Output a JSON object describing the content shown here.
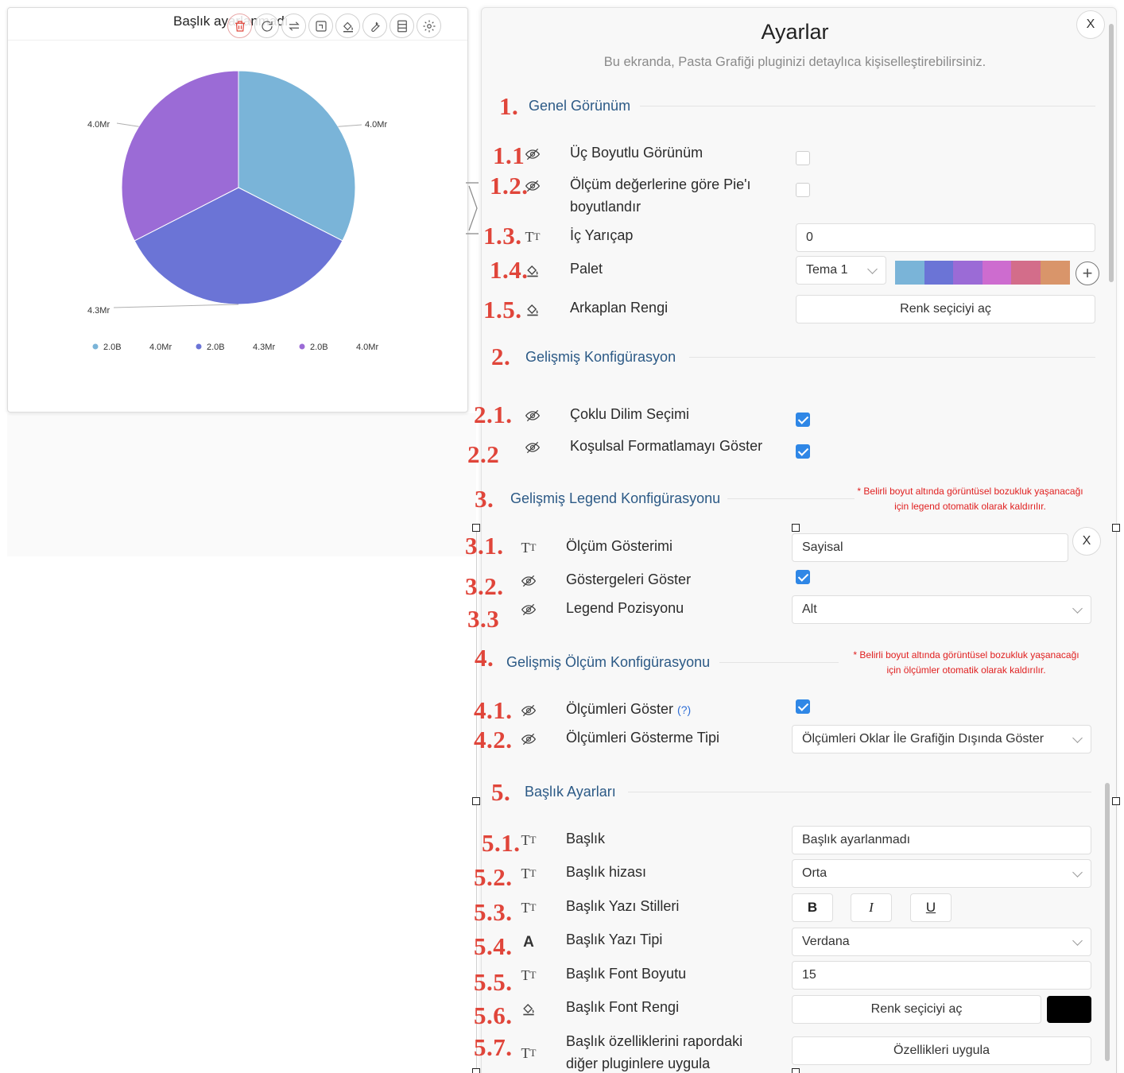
{
  "chart_card": {
    "title": "Başlık ayarlanmadı",
    "toolbar": [
      {
        "icon": "trash-icon"
      },
      {
        "icon": "refresh-icon"
      },
      {
        "icon": "swap-icon"
      },
      {
        "icon": "frame-icon"
      },
      {
        "icon": "paint-bucket-icon"
      },
      {
        "icon": "wrench-icon"
      },
      {
        "icon": "list-icon"
      },
      {
        "icon": "gear-icon"
      }
    ]
  },
  "chart_data": {
    "type": "pie",
    "title": "Başlık ayarlanmadı",
    "slices": [
      {
        "label": "4.0Mr",
        "legend_value": "2.0B",
        "legend_label": "4.0Mr",
        "value": 4.0,
        "color": "#7ab4d8"
      },
      {
        "label": "4.3Mr",
        "legend_value": "2.0B",
        "legend_label": "4.3Mr",
        "value": 4.3,
        "color": "#6b74d6"
      },
      {
        "label": "4.0Mr",
        "legend_value": "2.0B",
        "legend_label": "4.0Mr",
        "value": 4.0,
        "color": "#9b6bd6"
      }
    ],
    "legend_position": "bottom"
  },
  "panel": {
    "title": "Ayarlar",
    "subtitle": "Bu ekranda, Pasta Grafiği pluginizi detaylıca kişiselleştirebilirsiniz.",
    "close_label": "X",
    "sections": {
      "s1": {
        "num": "1.",
        "title": "Genel Görünüm"
      },
      "s2": {
        "num": "2.",
        "title": "Gelişmiş Konfigürasyon"
      },
      "s3": {
        "num": "3.",
        "title": "Gelişmiş Legend Konfigürasyonu",
        "note": "* Belirli boyut altında görüntüsel bozukluk yaşanacağı için legend otomatik olarak kaldırılır."
      },
      "s4": {
        "num": "4.",
        "title": "Gelişmiş Ölçüm Konfigürasyonu",
        "note": "* Belirli boyut altında görüntüsel bozukluk yaşanacağı için ölçümler otomatik olarak kaldırılır."
      },
      "s5": {
        "num": "5.",
        "title": "Başlık Ayarları"
      }
    },
    "rows": {
      "r11": {
        "num": "1.1",
        "label": "Üç Boyutlu Görünüm",
        "checked": false
      },
      "r12": {
        "num": "1.2.",
        "label": "Ölçüm değerlerine göre Pie'ı boyutlandır",
        "checked": false
      },
      "r13": {
        "num": "1.3.",
        "label": "İç Yarıçap",
        "value": "0"
      },
      "r14": {
        "num": "1.4.",
        "label": "Palet",
        "select": "Tema 1",
        "palette": [
          "#7ab4d8",
          "#6b74d6",
          "#9b6bd6",
          "#cd6ccf",
          "#d36d8a",
          "#d9956a"
        ]
      },
      "r15": {
        "num": "1.5.",
        "label": "Arkaplan Rengi",
        "button": "Renk seçiciyi aç"
      },
      "r21": {
        "num": "2.1.",
        "label": "Çoklu Dilim Seçimi",
        "checked": true
      },
      "r22": {
        "num": "2.2",
        "label": "Koşulsal Formatlamayı Göster",
        "checked": true
      },
      "r31": {
        "num": "3.1.",
        "label": "Ölçüm Gösterimi",
        "select": "Sayisal"
      },
      "r32": {
        "num": "3.2.",
        "label": "Göstergeleri Göster",
        "checked": true
      },
      "r33": {
        "num": "3.3",
        "label": "Legend Pozisyonu",
        "select": "Alt"
      },
      "r41": {
        "num": "4.1.",
        "label": "Ölçümleri Göster",
        "help": "(?)",
        "checked": true
      },
      "r42": {
        "num": "4.2.",
        "label": "Ölçümleri Gösterme Tipi",
        "select": "Ölçümleri Oklar İle Grafiğin Dışında Göster"
      },
      "r51": {
        "num": "5.1.",
        "label": "Başlık",
        "value": "Başlık ayarlanmadı"
      },
      "r52": {
        "num": "5.2.",
        "label": "Başlık hizası",
        "select": "Orta"
      },
      "r53": {
        "num": "5.3.",
        "label": "Başlık Yazı Stilleri",
        "bold": "B",
        "italic": "I",
        "underline": "U"
      },
      "r54": {
        "num": "5.4.",
        "label": "Başlık Yazı Tipi",
        "select": "Verdana"
      },
      "r55": {
        "num": "5.5.",
        "label": "Başlık Font Boyutu",
        "value": "15"
      },
      "r56": {
        "num": "5.6.",
        "label": "Başlık Font Rengi",
        "button": "Renk seçiciyi aç",
        "color": "#000000"
      },
      "r57": {
        "num": "5.7.",
        "label": "Başlık özelliklerini rapordaki diğer pluginlere uygula",
        "button": "Özellikleri uygula"
      }
    },
    "second_close_label": "X"
  }
}
